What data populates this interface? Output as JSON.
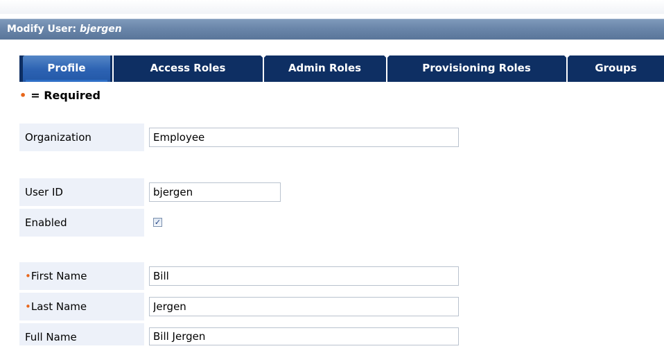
{
  "panel": {
    "title_prefix": "Modify User:",
    "title_user": "bjergen"
  },
  "tabs": [
    {
      "label": "Profile",
      "active": true
    },
    {
      "label": "Access Roles",
      "active": false
    },
    {
      "label": "Admin Roles",
      "active": false
    },
    {
      "label": "Provisioning Roles",
      "active": false
    },
    {
      "label": "Groups",
      "active": false
    }
  ],
  "required_note": {
    "marker": "•",
    "text": "= Required"
  },
  "form": {
    "organization": {
      "label": "Organization",
      "value": "Employee"
    },
    "user_id": {
      "label": "User ID",
      "value": "bjergen"
    },
    "enabled": {
      "label": "Enabled",
      "checked": true,
      "check_glyph": "✓"
    },
    "first_name": {
      "label": "First Name",
      "value": "Bill",
      "required_marker": "•"
    },
    "last_name": {
      "label": "Last Name",
      "value": "Jergen",
      "required_marker": "•"
    },
    "full_name": {
      "label": "Full Name",
      "value": "Bill Jergen"
    }
  },
  "colors": {
    "title_bar": "#6a86aa",
    "tab_bar": "#0e2f63",
    "tab_active": "#2c62b2",
    "label_cell": "#edf1f9",
    "required_marker": "#e8661a"
  }
}
